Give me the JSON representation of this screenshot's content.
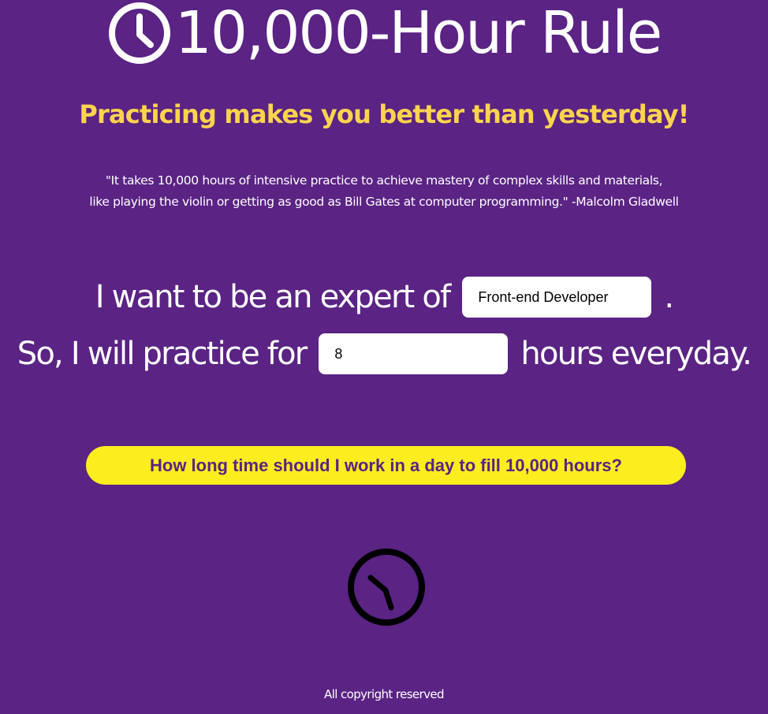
{
  "header": {
    "title": "10,000-Hour Rule",
    "subtitle": "Practicing makes you better than yesterday!",
    "title_icon": "clock-icon"
  },
  "quote": {
    "line1": "\"It takes 10,000 hours of intensive practice to achieve mastery of complex skills and materials,",
    "line2": "like playing the violin or getting as good as Bill Gates at computer programming.\" -Malcolm Gladwell"
  },
  "form": {
    "expert_prefix": "I want to be an expert of",
    "expert_value": "Front-end Developer",
    "expert_suffix": ".",
    "practice_prefix": "So, I will practice for",
    "hours_value": "8",
    "practice_suffix": "hours everyday."
  },
  "cta": {
    "label": "How long time should I work in a day to fill 10,000 hours?"
  },
  "loader": {
    "icon": "clock-icon"
  },
  "footer": {
    "text": "All copyright reserved"
  },
  "colors": {
    "background": "#5a2384",
    "subtitle": "#fcd34d",
    "button": "#fced1e",
    "button_text": "#5a2384"
  }
}
